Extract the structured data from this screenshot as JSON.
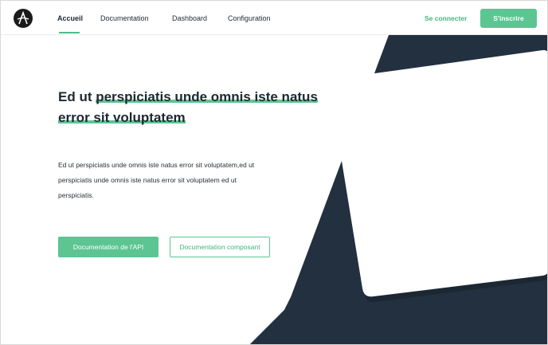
{
  "nav": {
    "logo_letter": "A",
    "items": [
      {
        "label": "Accueil",
        "active": true
      },
      {
        "label": "Documentation",
        "active": false
      },
      {
        "label": "Dashboard",
        "active": false
      },
      {
        "label": "Configuration",
        "active": false
      }
    ],
    "login_label": "Se connecter",
    "signup_label": "S'inscrire"
  },
  "hero": {
    "title_plain": "Ed ut ",
    "title_highlight": "perspiciatis unde omnis iste natus error sit voluptatem",
    "description": "Ed ut perspiciatis unde omnis iste natus error sit voluptatem,ed ut perspiciatis unde omnis iste natus error sit voluptatem ed ut perspiciatis.",
    "primary_button": "Documentation de l'API",
    "secondary_button": "Documentation composant"
  },
  "colors": {
    "accent": "#5cc592",
    "accent_text": "#3fb67f",
    "dark_shape": "#22303f",
    "text": "#1f2733"
  }
}
